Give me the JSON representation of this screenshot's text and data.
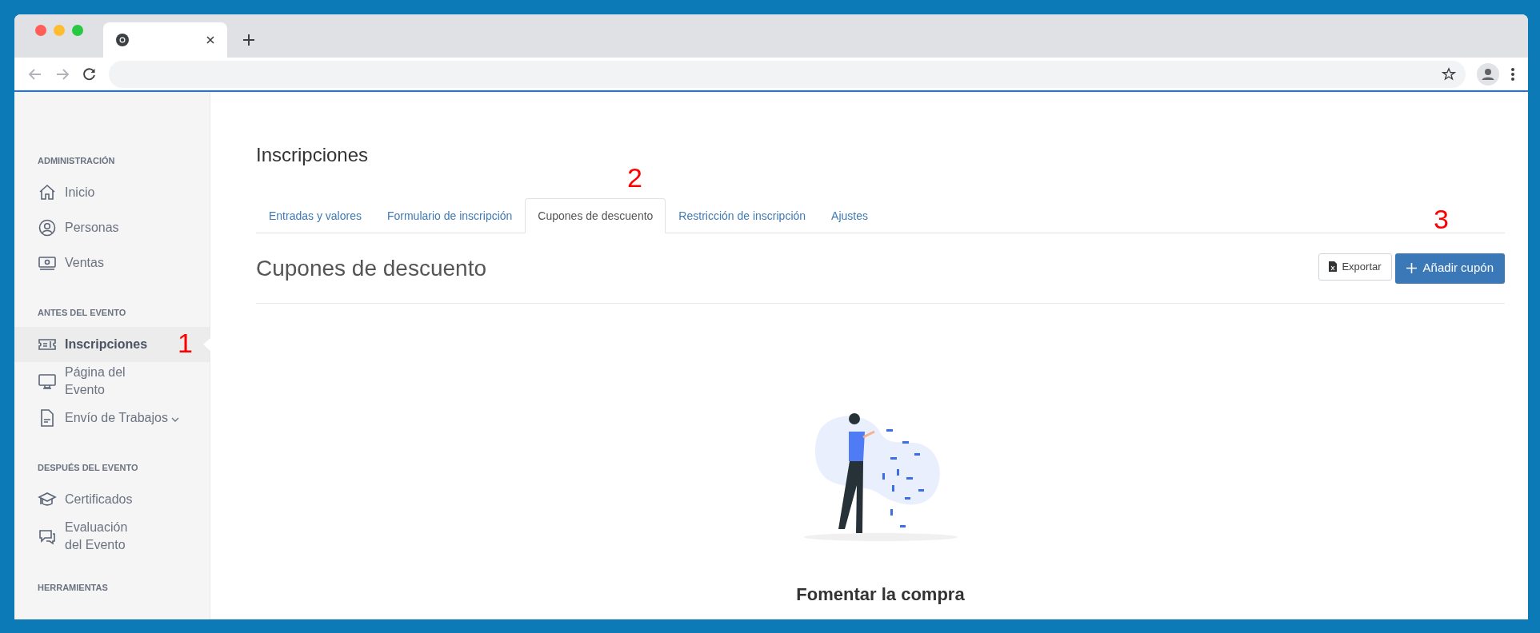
{
  "sidebar": {
    "sections": [
      {
        "heading": "ADMINISTRACIÓN",
        "items": [
          {
            "label": "Inicio",
            "selected": false,
            "expandable": false
          },
          {
            "label": "Personas",
            "selected": false,
            "expandable": false
          },
          {
            "label": "Ventas",
            "selected": false,
            "expandable": false
          }
        ]
      },
      {
        "heading": "ANTES DEL EVENTO",
        "items": [
          {
            "label": "Inscripciones",
            "selected": true,
            "expandable": false
          },
          {
            "label": "Página del Evento",
            "selected": false,
            "expandable": false
          },
          {
            "label": "Envío de Trabajos",
            "selected": false,
            "expandable": true
          }
        ]
      },
      {
        "heading": "DESPUÉS DEL EVENTO",
        "items": [
          {
            "label": "Certificados",
            "selected": false,
            "expandable": false
          },
          {
            "label": "Evaluación del Evento",
            "selected": false,
            "expandable": false
          }
        ]
      },
      {
        "heading": "HERRAMIENTAS"
      }
    ]
  },
  "page": {
    "title": "Inscripciones",
    "tabs": [
      {
        "label": "Entradas y valores",
        "selected": false
      },
      {
        "label": "Formulario de inscripción",
        "selected": false
      },
      {
        "label": "Cupones de descuento",
        "selected": true
      },
      {
        "label": "Restricción de inscripción",
        "selected": false
      },
      {
        "label": "Ajustes",
        "selected": false
      }
    ],
    "section_title": "Cupones de descuento",
    "buttons": [
      {
        "kind": "export",
        "label": "Exportar"
      },
      {
        "kind": "add",
        "label": "Añadir cupón"
      }
    ],
    "empty_state": {
      "title": "Fomentar la compra"
    }
  },
  "annotations": [
    {
      "label": "1"
    },
    {
      "label": "2"
    },
    {
      "label": "3"
    }
  ]
}
